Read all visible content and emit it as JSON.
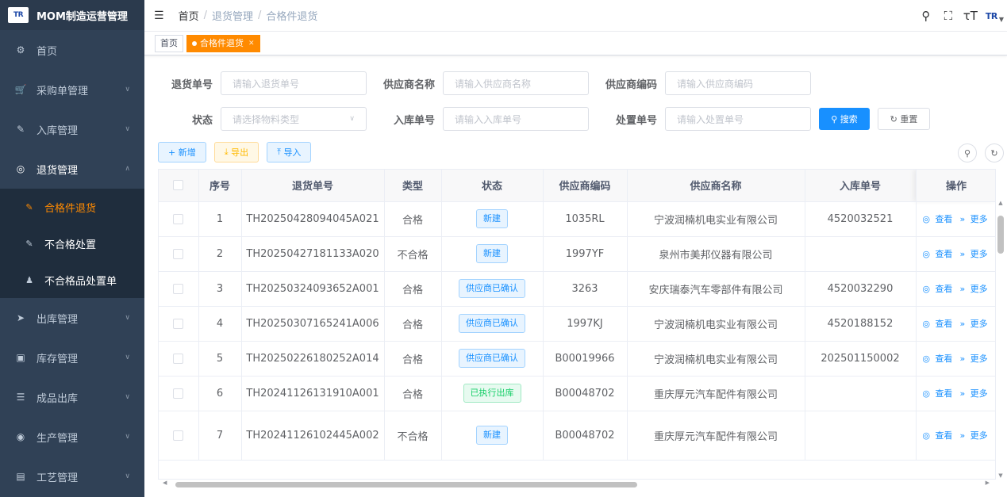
{
  "app": {
    "logo_text": "TR",
    "title": "MOM制造运营管理"
  },
  "sidebar": {
    "items": [
      {
        "icon": "dashboard-icon",
        "glyph": "⌂",
        "label": "首页"
      },
      {
        "icon": "cart-icon",
        "glyph": "🛒",
        "label": "采购单管理"
      },
      {
        "icon": "edit-icon",
        "glyph": "✎",
        "label": "入库管理"
      },
      {
        "icon": "return-icon",
        "glyph": "◎",
        "label": "退货管理"
      }
    ],
    "submenu": [
      {
        "label": "合格件退货"
      },
      {
        "label": "不合格处置"
      },
      {
        "label": "不合格品处置单"
      }
    ],
    "items_after": [
      {
        "label": "出库管理"
      },
      {
        "label": "库存管理"
      },
      {
        "label": "成品出库"
      },
      {
        "label": "生产管理"
      },
      {
        "label": "工艺管理"
      }
    ]
  },
  "header": {
    "breadcrumb": [
      "首页",
      "退货管理",
      "合格件退货"
    ],
    "logo_text": "TR"
  },
  "tags": [
    {
      "label": "首页"
    },
    {
      "label": "合格件退货"
    }
  ],
  "form": {
    "return_no": {
      "label": "退货单号",
      "placeholder": "请输入退货单号"
    },
    "supplier_name": {
      "label": "供应商名称",
      "placeholder": "请输入供应商名称"
    },
    "supplier_code": {
      "label": "供应商编码",
      "placeholder": "请输入供应商编码"
    },
    "status": {
      "label": "状态",
      "placeholder": "请选择物料类型"
    },
    "inbound_no": {
      "label": "入库单号",
      "placeholder": "请输入入库单号"
    },
    "disposal_no": {
      "label": "处置单号",
      "placeholder": "请输入处置单号"
    },
    "search_label": "搜索",
    "reset_label": "重置"
  },
  "toolbar": {
    "add_label": "新增",
    "export_label": "导出",
    "import_label": "导入"
  },
  "table": {
    "headers": [
      "序号",
      "退货单号",
      "类型",
      "状态",
      "供应商编码",
      "供应商名称",
      "入库单号",
      "操作"
    ],
    "view_label": "查看",
    "more_label": "更多",
    "rows": [
      {
        "idx": "1",
        "no": "TH20250428094045A021",
        "type": "合格",
        "status": "新建",
        "scode": "1035RL",
        "sname": "宁波润楠机电实业有限公司",
        "inbound": "4520032521"
      },
      {
        "idx": "2",
        "no": "TH20250427181133A020",
        "type": "不合格",
        "status": "新建",
        "scode": "1997YF",
        "sname": "泉州市美邦仪器有限公司",
        "inbound": ""
      },
      {
        "idx": "3",
        "no": "TH20250324093652A001",
        "type": "合格",
        "status": "供应商已确认",
        "scode": "3263",
        "sname": "安庆瑞泰汽车零部件有限公司",
        "inbound": "4520032290"
      },
      {
        "idx": "4",
        "no": "TH20250307165241A006",
        "type": "合格",
        "status": "供应商已确认",
        "scode": "1997KJ",
        "sname": "宁波润楠机电实业有限公司",
        "inbound": "4520188152"
      },
      {
        "idx": "5",
        "no": "TH20250226180252A014",
        "type": "合格",
        "status": "供应商已确认",
        "scode": "B00019966",
        "sname": "宁波润楠机电实业有限公司",
        "inbound": "202501150002"
      },
      {
        "idx": "6",
        "no": "TH20241126131910A001",
        "type": "合格",
        "status": "已执行出库",
        "scode": "B00048702",
        "sname": "重庆厚元汽车配件有限公司",
        "inbound": ""
      },
      {
        "idx": "7",
        "no": "TH20241126102445A002",
        "type": "不合格",
        "status": "新建",
        "scode": "B00048702",
        "sname": "重庆厚元汽车配件有限公司",
        "inbound": ""
      }
    ]
  }
}
